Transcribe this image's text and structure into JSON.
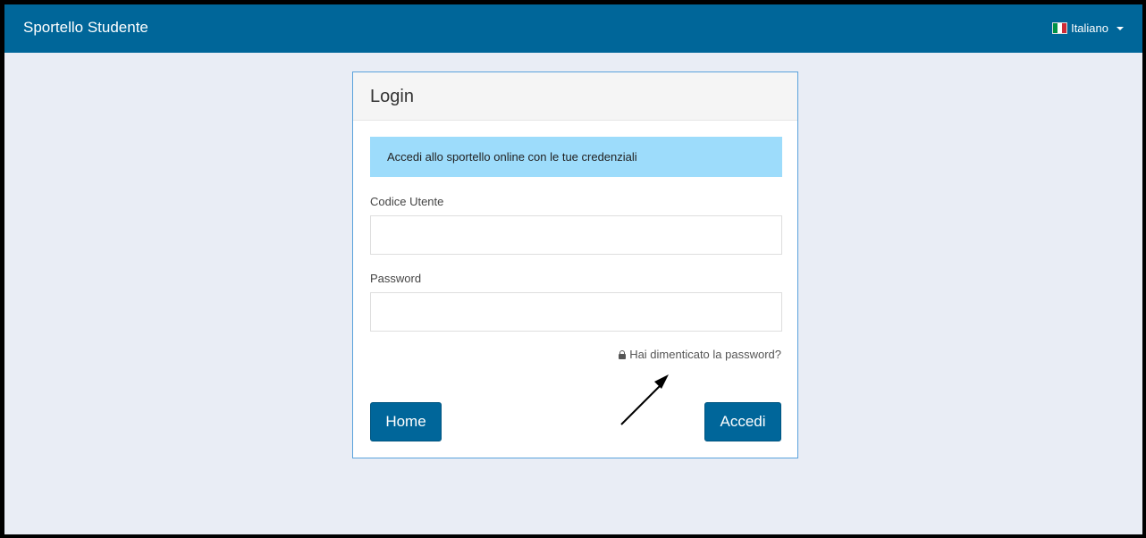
{
  "navbar": {
    "brand": "Sportello Studente",
    "language": {
      "label": "Italiano",
      "flag_colors": [
        "#009246",
        "#ffffff",
        "#ce2b37"
      ]
    }
  },
  "login": {
    "title": "Login",
    "info_message": "Accedi allo sportello online con le tue credenziali",
    "username": {
      "label": "Codice Utente",
      "value": "",
      "placeholder": ""
    },
    "password": {
      "label": "Password",
      "value": "",
      "placeholder": ""
    },
    "forgot_password": {
      "icon": "lock-icon",
      "label": "Hai dimenticato la password?"
    },
    "home_button": "Home",
    "submit_button": "Accedi"
  },
  "colors": {
    "navbar": "#006699",
    "page_background": "#e9edf5",
    "alert_background": "#9ddcfb",
    "button": "#00669a",
    "panel_border": "#5aa2dc"
  }
}
